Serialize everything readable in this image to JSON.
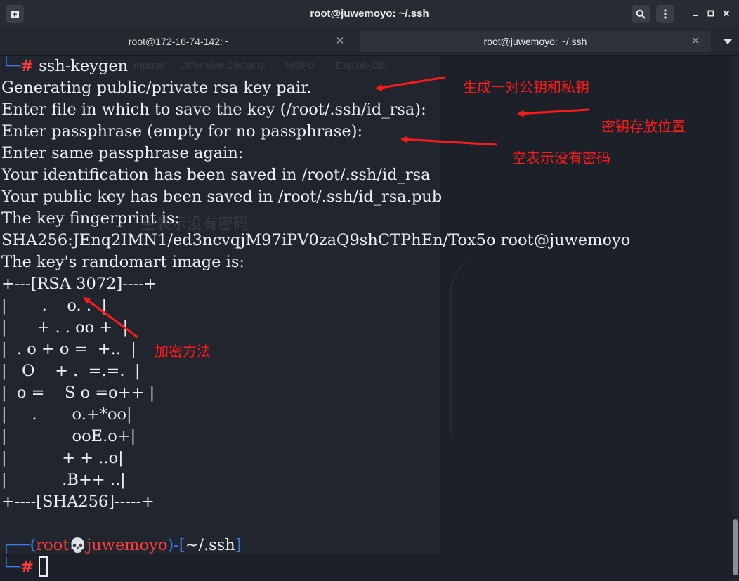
{
  "window": {
    "title": "root@juwemoyo: ~/.ssh"
  },
  "titlebar": {
    "new_tab_icon": "new-tab-icon",
    "search_icon": "search-icon",
    "menu_icon": "kebab-menu-icon",
    "minimize_icon": "minimize-icon",
    "maximize_icon": "maximize-icon",
    "close_icon": "close-icon"
  },
  "tabs": [
    {
      "label": "root@172-16-74-142:~",
      "active": false
    },
    {
      "label": "root@juwemoyo: ~/.ssh",
      "active": true
    }
  ],
  "terminal": {
    "lines": [
      {
        "prefix": "└─",
        "hash": "#",
        "text": " ssh-keygen"
      },
      {
        "text": "Generating public/private rsa key pair."
      },
      {
        "text": "Enter file in which to save the key (/root/.ssh/id_rsa):"
      },
      {
        "text": "Enter passphrase (empty for no passphrase):"
      },
      {
        "text": "Enter same passphrase again:"
      },
      {
        "text": "Your identification has been saved in /root/.ssh/id_rsa"
      },
      {
        "text": "Your public key has been saved in /root/.ssh/id_rsa.pub"
      },
      {
        "text": "The key fingerprint is:"
      },
      {
        "text": "SHA256:JEnq2IMN1/ed3ncvqjM97iPV0zaQ9shCTPhEn/Tox5o root@juwemoyo"
      },
      {
        "text": "The key's randomart image is:"
      },
      {
        "text": "+---[RSA 3072]----+"
      },
      {
        "text": "|       .    o. .  |"
      },
      {
        "text": "|      + . . oo +  |"
      },
      {
        "text": "|  . o + o =  +..  |"
      },
      {
        "text": "|   O    + .  =.=.  |"
      },
      {
        "text": "|  o =    S o =o++ |"
      },
      {
        "text": "|     .       o.+*oo|"
      },
      {
        "text": "|             ooE.o+|"
      },
      {
        "text": "|           + + ..o|"
      },
      {
        "text": "|           .B++ ..|"
      },
      {
        "text": "+----[SHA256]-----+"
      },
      {
        "text": ""
      }
    ],
    "prompt": {
      "frame_top": "┌──(",
      "user": "root",
      "skull": "💀",
      "host": "juwemoyo",
      "mid": ")-[",
      "path": "~/.ssh",
      "end": "]",
      "frame_bottom": "└─",
      "hash": "#"
    }
  },
  "annotations": {
    "keypair": "生成一对公钥和私钥",
    "location": "密钥存放位置",
    "empty_passphrase": "空表示没有密码",
    "encryption": "加密方法",
    "color": "#ff1a1a"
  },
  "ghost": {
    "bookmarks": [
      "mputer",
      "Offensive Security",
      "MSFU",
      "Exploit-DB"
    ],
    "overlay_text": "空表示没有密码"
  }
}
